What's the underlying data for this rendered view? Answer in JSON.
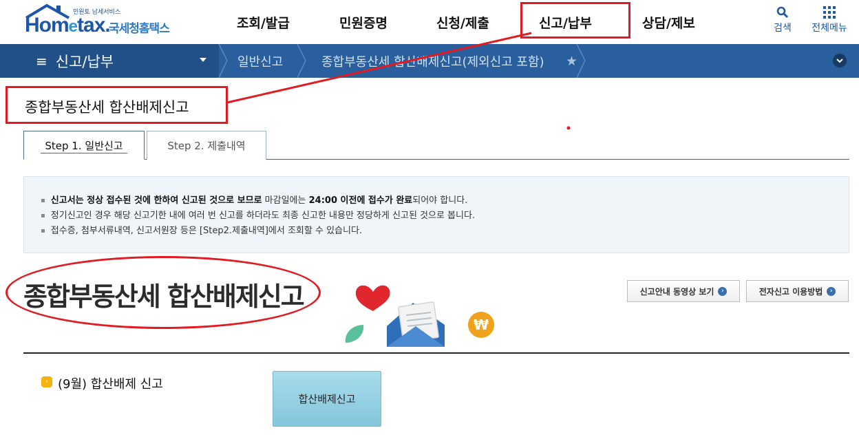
{
  "header": {
    "logo_small": "민원토 남세서비스",
    "logo_home": "Hom",
    "logo_e": "e",
    "logo_tax": "tax.",
    "logo_kor": "국세청홈택스",
    "menu": [
      "조회/발급",
      "민원증명",
      "신청/제출",
      "신고/납부",
      "상담/제보"
    ],
    "search_label": "검색",
    "allmenu_label": "전체메뉴"
  },
  "nav": {
    "title": "신고/납부",
    "crumb1": "일반신고",
    "crumb2": "종합부동산세 합산배제신고(제외신고 포함)"
  },
  "page_heading": "종합부동산세 합산배제신고",
  "tabs": [
    "Step 1. 일반신고",
    "Step 2. 제출내역"
  ],
  "notices": {
    "n1_bold1": "신고서는 정상 접수된 것에 한하여 신고된 것으로 보므로",
    "n1_mid": " 마감일에는 ",
    "n1_bold2": "24:00 이전에 접수가 완료",
    "n1_end": "되어야 합니다.",
    "n2": "정기신고인 경우 해당 신고기한 내에 여러 번 신고를 하더라도 최종 신고한 내용만 정당하게 신고된 것으로 봅니다.",
    "n3": "접수증, 첨부서류내역, 신고서원장 등은 [Step2.제출내역]에서 조회할 수 있습니다."
  },
  "big_title": "종합부동산세 합산배제신고",
  "buttons": {
    "video": "신고안내 동영상 보기",
    "howto": "전자신고 이용방법"
  },
  "section": {
    "label": "(9월) 합산배제 신고",
    "button": "합산배제신고"
  },
  "colors": {
    "nav_bg": "#2a5f9e",
    "highlight_red": "#e11b22",
    "button_teal": "#96d1e4"
  }
}
